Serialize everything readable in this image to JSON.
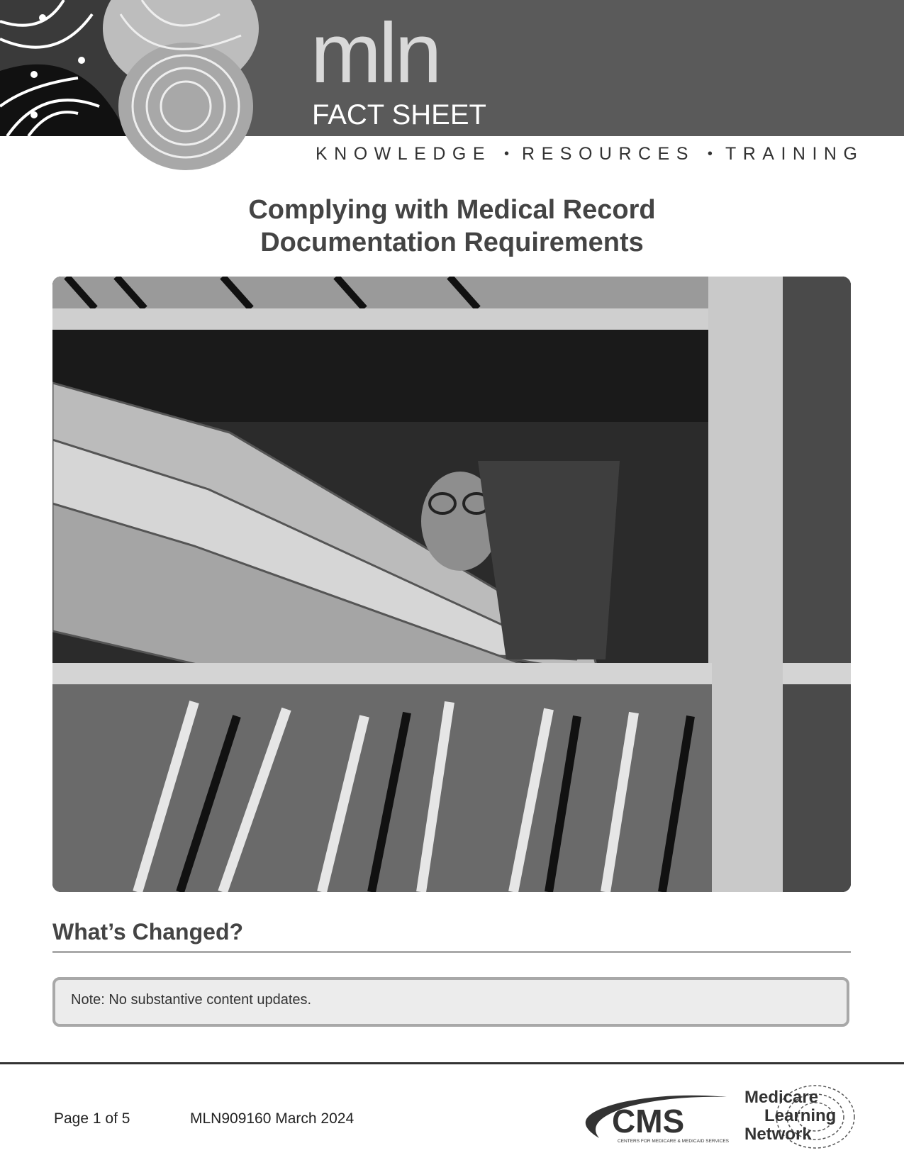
{
  "header": {
    "brand": "mln",
    "label": "FACT SHEET",
    "tagline": [
      "KNOWLEDGE",
      "RESOURCES",
      "TRAINING"
    ],
    "tagline_separator": "•"
  },
  "document": {
    "title_line1": "Complying with Medical Record",
    "title_line2": "Documentation Requirements",
    "photo_alt": "Person searching through shelves of medical record folders"
  },
  "whats_changed": {
    "heading": "What’s Changed?",
    "note": "Note: No substantive content updates."
  },
  "footer": {
    "page": "Page 1 of 5",
    "doc_code": "MLN909160 March 2024",
    "cms_logo_text": "CMS",
    "cms_tagline": "CENTERS FOR MEDICARE & MEDICAID SERVICES",
    "mln_logo_lines": [
      "Medicare",
      "Learning",
      "Network"
    ]
  },
  "colors": {
    "header_band": "#5a5a5a",
    "heading_text": "#444444",
    "note_background": "#ececec",
    "note_border": "#a8a8a8"
  }
}
